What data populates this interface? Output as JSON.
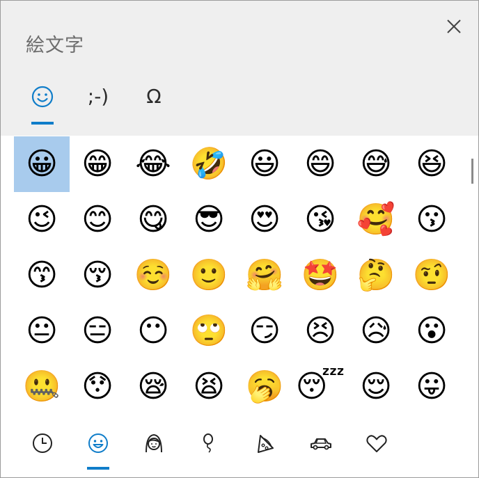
{
  "title": "絵文字",
  "colors": {
    "accent": "#0f7dc9",
    "selected_bg": "#a8cbed",
    "header_bg": "#efefef"
  },
  "tabs": [
    {
      "name": "emoji",
      "label": "",
      "icon": "smiley-icon",
      "active": true
    },
    {
      "name": "kaomoji",
      "label": ";-)",
      "active": false
    },
    {
      "name": "symbols",
      "label": "Ω",
      "active": false
    }
  ],
  "emoji_grid": [
    [
      "😀",
      "😁",
      "😂",
      "🤣",
      "😃",
      "😄",
      "😅",
      "😆"
    ],
    [
      "😉",
      "😊",
      "😋",
      "😎",
      "😍",
      "😘",
      "🥰",
      "😗"
    ],
    [
      "😙",
      "😚",
      "☺️",
      "🙂",
      "🤗",
      "🤩",
      "🤔",
      "🤨"
    ],
    [
      "😐",
      "😑",
      "😶",
      "🙄",
      "😏",
      "😣",
      "😥",
      "😮"
    ],
    [
      "🤐",
      "😯",
      "😪",
      "😫",
      "🥱",
      "😴",
      "😌",
      "😛"
    ]
  ],
  "categories": [
    {
      "name": "recent",
      "icon": "clock-icon",
      "active": false
    },
    {
      "name": "smileys",
      "icon": "smiley-icon",
      "active": true
    },
    {
      "name": "people",
      "icon": "person-icon",
      "active": false
    },
    {
      "name": "celebration",
      "icon": "balloon-icon",
      "active": false
    },
    {
      "name": "food",
      "icon": "pizza-icon",
      "active": false
    },
    {
      "name": "travel",
      "icon": "car-icon",
      "active": false
    },
    {
      "name": "symbols",
      "icon": "heart-icon",
      "active": false
    }
  ]
}
